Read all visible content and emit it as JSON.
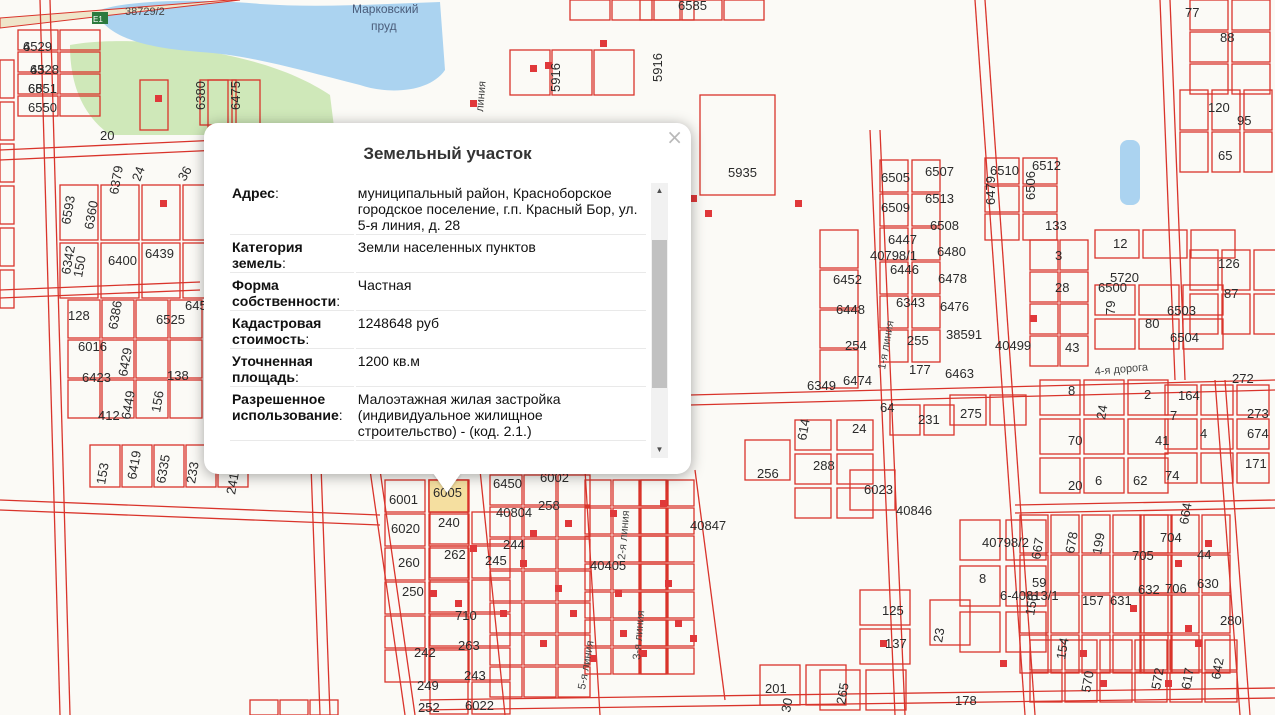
{
  "map": {
    "pond_name": "Марковский пруд",
    "road_top": "38729/2",
    "route_badge": "E1",
    "parcel_labels": [
      "6529",
      "6528",
      "6551",
      "6550",
      "6585",
      "5916",
      "5916",
      "6380",
      "6475",
      "20",
      "6379",
      "24",
      "36",
      "5935",
      "6505",
      "6507",
      "6509",
      "6513",
      "6447",
      "6508",
      "6446",
      "6480",
      "6343",
      "6478",
      "6476",
      "38591",
      "255",
      "177",
      "6463",
      "6452",
      "6448",
      "254",
      "6474",
      "6349",
      "40798/1",
      "40499",
      "6500",
      "6510",
      "6512",
      "6479",
      "6506",
      "133",
      "3",
      "28",
      "43",
      "12",
      "5720",
      "79",
      "80",
      "6503",
      "6504",
      "120",
      "95",
      "65",
      "126",
      "87",
      "272",
      "273",
      "674",
      "171",
      "77",
      "88",
      "2",
      "164",
      "41",
      "4",
      "70",
      "6",
      "62",
      "74",
      "6593",
      "6360",
      "6342",
      "150",
      "6400",
      "6439",
      "128",
      "6386",
      "6525",
      "6455",
      "6016",
      "6423",
      "6429",
      "138",
      "412",
      "6449",
      "156",
      "153",
      "6419",
      "6335",
      "233",
      "241",
      "614",
      "24",
      "231",
      "275",
      "288",
      "256",
      "6023",
      "6001",
      "6005",
      "6020",
      "240",
      "260",
      "262",
      "250",
      "710",
      "242",
      "263",
      "249",
      "243",
      "252",
      "6022",
      "6450",
      "6002",
      "40804",
      "258",
      "244",
      "245",
      "40405",
      "40847",
      "40846",
      "40798/2",
      "8",
      "125",
      "137",
      "23",
      "667",
      "678",
      "199",
      "705",
      "704",
      "44",
      "59",
      "157",
      "631",
      "632",
      "706",
      "630",
      "156",
      "280",
      "154",
      "570",
      "572",
      "617",
      "642",
      "664",
      "265",
      "30",
      "178",
      "201",
      "6-40813/1",
      "7",
      "8",
      "64",
      "48",
      "24",
      "20",
      "4",
      "43",
      "68"
    ],
    "street_labels": [
      "1-я линия",
      "5-я линия",
      "4-я дорога",
      "3-я линия",
      "2-я линия",
      "линия"
    ]
  },
  "popup": {
    "title": "Земельный участок",
    "close_glyph": "×",
    "rows": [
      {
        "key": "Адрес",
        "colon": ":",
        "value": "муниципальный район, Красноборское городское поселение, г.п. Красный Бор, ул. 5-я линия, д. 28"
      },
      {
        "key": "Категория земель",
        "colon": ":",
        "value": "Земли населенных пунктов"
      },
      {
        "key": "Форма собственности",
        "colon": ":",
        "value": "Частная"
      },
      {
        "key": "Кадастровая стоимость",
        "colon": ":",
        "value": "1248648 руб"
      },
      {
        "key": "Уточненная площадь",
        "colon": ":",
        "value": "1200 кв.м"
      },
      {
        "key": "Разрешенное использование",
        "colon": ":",
        "value": "Малоэтажная жилая застройка (индивидуальное жилищное строительство) - (код. 2.1.)"
      }
    ]
  },
  "colors": {
    "parcel_line": "#d9342b",
    "building": "#e0383a",
    "water": "#abd3f0",
    "green": "#cfe8b9",
    "road": "#f0ede5",
    "selected": "#f5dfa0"
  }
}
